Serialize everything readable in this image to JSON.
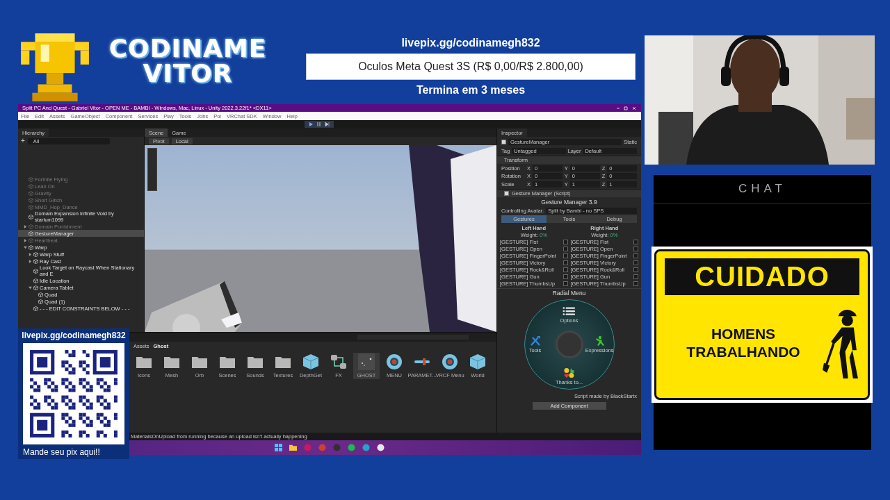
{
  "logo": {
    "line1": "CODINAME",
    "line2": "VITOR"
  },
  "goal": {
    "link": "livepix.gg/codinamegh832",
    "title": "Oculos Meta Quest 3S (R$ 0,00/R$ 2.800,00)",
    "level": 0,
    "ends": "Termina em 3 meses"
  },
  "chat": {
    "title": "CHAT"
  },
  "sign": {
    "heading": "CUIDADO",
    "text": "HOMENS TRABALHANDO"
  },
  "donation": {
    "link": "livepix.gg/codinamegh832",
    "caption": "Mande seu pix aqui!!"
  },
  "editor": {
    "title": "Split PC And Quest - Gabriel Vitor - OPEN ME - BAMBI - Windows, Mac, Linux - Unity 2022.3.22f1* <DX11>",
    "menu": [
      "File",
      "Edit",
      "Assets",
      "GameObject",
      "Component",
      "Services",
      "Play",
      "Tools",
      "Jobs",
      "Poi",
      "VRChat SDK",
      "Window",
      "Help"
    ],
    "hierarchy": {
      "title": "Hierarchy",
      "add": "+",
      "search": "All",
      "items": [
        {
          "label": "Fortnite Flying",
          "disabled": true,
          "selected": false
        },
        {
          "label": "Lean On",
          "disabled": true,
          "selected": false
        },
        {
          "label": "Gravity",
          "disabled": true,
          "selected": false
        },
        {
          "label": "Short Glitch",
          "disabled": true,
          "selected": false
        },
        {
          "label": "MMD_Hop_Dance",
          "disabled": true,
          "selected": false
        },
        {
          "label": "Domain Expansion Infinite Void by starlum1099",
          "disabled": false,
          "selected": false
        },
        {
          "label": "Domain Punishment",
          "disabled": true,
          "selected": false,
          "expanded": false
        },
        {
          "label": "GestureManager",
          "disabled": false,
          "selected": true
        },
        {
          "label": "Heartbeat",
          "disabled": true,
          "selected": false,
          "expanded": false
        },
        {
          "label": "Warp",
          "disabled": false,
          "selected": false,
          "expanded": true,
          "children": [
            {
              "label": "Warp Stuff",
              "disabled": false,
              "selected": false,
              "expanded": false
            },
            {
              "label": "Ray Cast",
              "disabled": false,
              "selected": false,
              "expanded": false
            },
            {
              "label": "Look Target on Raycast When Stationary and E",
              "disabled": false,
              "selected": false
            },
            {
              "label": "Idle Location",
              "disabled": false,
              "selected": false
            },
            {
              "label": "Camera Tablet",
              "disabled": false,
              "selected": false,
              "expanded": true,
              "children": [
                {
                  "label": "Quad",
                  "disabled": false,
                  "selected": false
                },
                {
                  "label": "Quad (1)",
                  "disabled": false,
                  "selected": false
                }
              ]
            },
            {
              "label": "- - - EDIT CONSTRAINTS BELOW - - -",
              "disabled": false,
              "selected": false
            }
          ]
        }
      ]
    },
    "scene_tabs": [
      {
        "label": "Scene",
        "selected": true
      },
      {
        "label": "Game",
        "selected": false
      }
    ],
    "scene_toolbar": [
      "Pivot",
      "Local"
    ],
    "inspector": {
      "title": "Inspector",
      "object": "GestureManager",
      "active": true,
      "static": "Static",
      "tag_label": "Tag",
      "tag": "Untagged",
      "layer_label": "Layer",
      "layer": "Default",
      "transform": {
        "title": "Transform",
        "rows": [
          {
            "label": "Position",
            "values": [
              {
                "axis": "X",
                "value": "0"
              },
              {
                "axis": "Y",
                "value": "0"
              },
              {
                "axis": "Z",
                "value": "0"
              }
            ]
          },
          {
            "label": "Rotation",
            "values": [
              {
                "axis": "X",
                "value": "0"
              },
              {
                "axis": "Y",
                "value": "0"
              },
              {
                "axis": "Z",
                "value": "0"
              }
            ]
          },
          {
            "label": "Scale",
            "values": [
              {
                "axis": "X",
                "value": "1"
              },
              {
                "axis": "Y",
                "value": "1"
              },
              {
                "axis": "Z",
                "value": "1"
              }
            ]
          }
        ]
      },
      "script": {
        "title": "Gesture Manager (Script)",
        "enabled": true,
        "heading": "Gesture Manager 3.9",
        "avatar_label": "Controlling Avatar:",
        "avatar": "Split by Bambi - no SPS",
        "tabs": [
          {
            "label": "Gestures",
            "selected": true
          },
          {
            "label": "Tools",
            "selected": false
          },
          {
            "label": "Debug",
            "selected": false
          }
        ],
        "hands": [
          {
            "title": "Left Hand",
            "weight_label": "Weight:",
            "weight": "0%",
            "gestures": [
              {
                "label": "[GESTURE] Fist",
                "checked": false
              },
              {
                "label": "[GESTURE] Open",
                "checked": false
              },
              {
                "label": "[GESTURE] FingerPoint",
                "checked": false
              },
              {
                "label": "[GESTURE] Victory",
                "checked": false
              },
              {
                "label": "[GESTURE] Rock&Roll",
                "checked": false
              },
              {
                "label": "[GESTURE] Gun",
                "checked": false
              },
              {
                "label": "[GESTURE] ThumbsUp",
                "checked": false
              }
            ]
          },
          {
            "title": "Right Hand",
            "weight_label": "Weight:",
            "weight": "0%",
            "gestures": [
              {
                "label": "[GESTURE] Fist",
                "checked": false
              },
              {
                "label": "[GESTURE] Open",
                "checked": false
              },
              {
                "label": "[GESTURE] FingerPoint",
                "checked": false
              },
              {
                "label": "[GESTURE] Victory",
                "checked": false
              },
              {
                "label": "[GESTURE] Rock&Roll",
                "checked": false
              },
              {
                "label": "[GESTURE] Gun",
                "checked": false
              },
              {
                "label": "[GESTURE] ThumbsUp",
                "checked": false
              }
            ]
          }
        ],
        "radial": {
          "title": "Radial Menu",
          "options": [
            {
              "kind": "options",
              "label": "Options"
            },
            {
              "kind": "tools",
              "label": "Tools"
            },
            {
              "kind": "expressions",
              "label": "Expressions"
            },
            {
              "kind": "thanks",
              "label": "Thanks to..."
            }
          ]
        },
        "credit": "Script made by BlackStartx"
      },
      "add_button": "Add Component"
    },
    "project": {
      "breadcrumb": [
        "Assets",
        "Ghost"
      ],
      "items": [
        {
          "kind": "folder",
          "label": "Icons",
          "selected": false
        },
        {
          "kind": "folder",
          "label": "Mesh",
          "selected": false
        },
        {
          "kind": "folder",
          "label": "Orb",
          "selected": false
        },
        {
          "kind": "folder",
          "label": "Scenes",
          "selected": false
        },
        {
          "kind": "folder",
          "label": "Sounds",
          "selected": false
        },
        {
          "kind": "folder",
          "label": "Textures",
          "selected": false
        },
        {
          "kind": "cube",
          "label": "DepthGet",
          "selected": false
        },
        {
          "kind": "nodes",
          "label": "FX",
          "selected": false
        },
        {
          "kind": "particles",
          "label": "GHOST",
          "selected": true
        },
        {
          "kind": "disc",
          "label": "MENU",
          "selected": false
        },
        {
          "kind": "slider",
          "label": "PARAMET...",
          "selected": false
        },
        {
          "kind": "disc",
          "label": "VRCF Menu",
          "selected": false
        },
        {
          "kind": "cube",
          "label": "World",
          "selected": false
        }
      ]
    },
    "status": "MaterialsOnUpload from running because an upload isn't actually happening",
    "taskbar": [
      {
        "kind": "start"
      },
      {
        "kind": "folder"
      },
      {
        "kind": "app",
        "color": "#c8185e"
      },
      {
        "kind": "app",
        "color": "#d0402a"
      },
      {
        "kind": "app",
        "color": "#303030"
      },
      {
        "kind": "app",
        "color": "#1db954"
      },
      {
        "kind": "app",
        "color": "#27a3c9"
      },
      {
        "kind": "app",
        "color": "#e8e8e8"
      }
    ]
  }
}
